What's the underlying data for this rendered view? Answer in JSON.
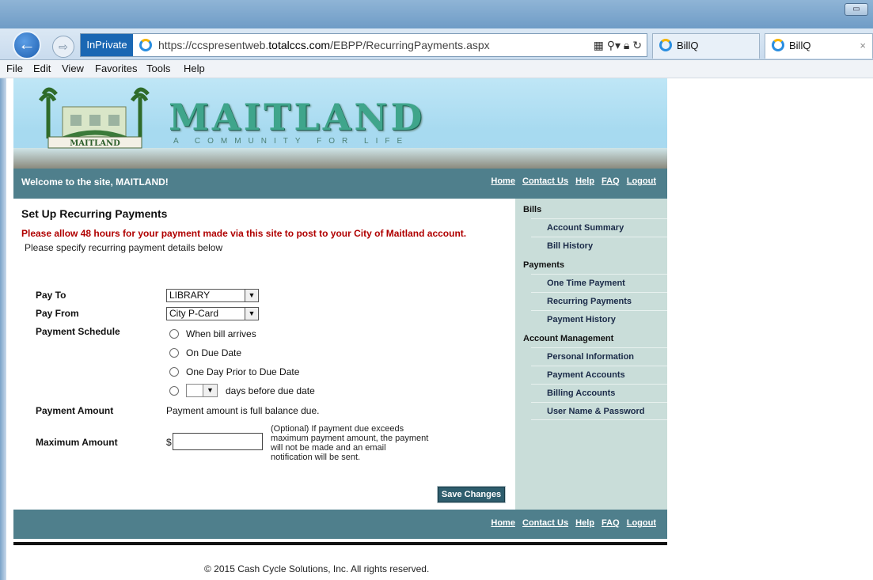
{
  "browser": {
    "inprivate_label": "InPrivate",
    "url_prefix": "https://ccspresentweb.",
    "url_domain": "totalccs.com",
    "url_path": "/EBPP/RecurringPayments.aspx",
    "tabs": [
      {
        "label": "BillQ",
        "active": false
      },
      {
        "label": "BillQ",
        "active": true
      }
    ],
    "menu": [
      "File",
      "Edit",
      "View",
      "Favorites",
      "Tools",
      "Help"
    ]
  },
  "banner": {
    "brand": "MAITLAND",
    "tagline": "A COMMUNITY FOR LIFE",
    "logo_text": "MAITLAND"
  },
  "header": {
    "welcome": "Welcome to the site, MAITLAND!",
    "links": [
      "Home",
      "Contact Us",
      "Help",
      "FAQ",
      "Logout"
    ]
  },
  "main": {
    "title": "Set Up Recurring Payments",
    "notice": "Please allow 48 hours for your payment made via this site to post to your City of Maitland account.",
    "instructions": "Please specify recurring payment details below",
    "pay_to_label": "Pay To",
    "pay_to_value": "LIBRARY",
    "pay_from_label": "Pay From",
    "pay_from_value": "City P-Card",
    "schedule_label": "Payment Schedule",
    "schedule_options": [
      "When bill arrives",
      "On Due Date",
      "One Day Prior to Due Date",
      "days before due date"
    ],
    "amount_label": "Payment Amount",
    "amount_text": "Payment amount is full balance due.",
    "max_label": "Maximum Amount",
    "currency": "$",
    "max_value": "",
    "optional_note": "(Optional) If payment due exceeds maximum payment amount, the payment will not be made and an email notification will be sent.",
    "save_label": "Save Changes"
  },
  "sidebar": {
    "bills_heading": "Bills",
    "bills_items": [
      "Account Summary",
      "Bill History"
    ],
    "payments_heading": "Payments",
    "payments_items": [
      "One Time Payment",
      "Recurring Payments",
      "Payment History"
    ],
    "account_heading": "Account Management",
    "account_items": [
      "Personal Information",
      "Payment Accounts",
      "Billing Accounts",
      "User Name & Password"
    ]
  },
  "footer": {
    "links": [
      "Home",
      "Contact Us",
      "Help",
      "FAQ",
      "Logout"
    ],
    "copyright": "© 2015 Cash Cycle Solutions, Inc. All rights reserved."
  },
  "colors": {
    "teal_bar": "#4f7f8c",
    "sidebar_bg": "#c9ddd9",
    "notice_red": "#b00000",
    "brand_green": "#3fa58b"
  }
}
